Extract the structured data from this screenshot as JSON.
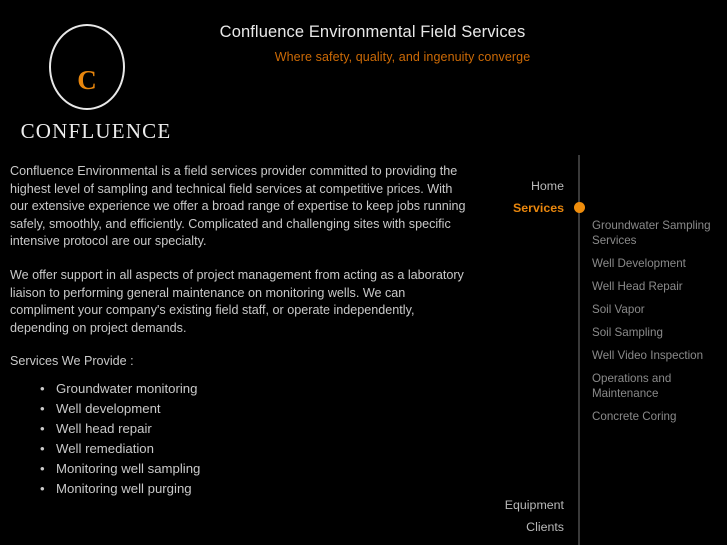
{
  "page": {
    "background_color": "#000000",
    "accent_color": "#e8860d",
    "text_color": "#c9c9c9",
    "muted_text_color": "#8a8a8a",
    "rule_color": "#3a3a3a"
  },
  "header": {
    "logo": {
      "ring_icon": "circle-outline-icon",
      "monogram": "C",
      "wordmark": "CONFLUENCE"
    },
    "title": "Confluence Environmental Field Services",
    "tagline": "Where safety, quality, and ingenuity converge"
  },
  "content": {
    "paragraphs": [
      "Confluence Environmental is a field services provider committed to providing the highest level of sampling and technical field services at competitive prices. With our extensive experience we offer a broad range of expertise to keep jobs running safely, smoothly, and efficiently. Complicated and challenging sites with specific intensive protocol are our specialty.",
      "We offer support in all aspects of project management from acting as a laboratory liaison to performing general maintenance on monitoring wells. We can compliment your company's existing field staff, or operate independently, depending on project demands."
    ],
    "services_heading": "Services We Provide :",
    "services": [
      "Groundwater monitoring",
      "Well development",
      "Well head repair",
      "Well remediation",
      "Monitoring well sampling",
      "Monitoring well purging"
    ]
  },
  "nav": {
    "top_items": [
      {
        "label": "Home",
        "active": false
      },
      {
        "label": "Services",
        "active": true
      },
      {
        "label": "Equipment",
        "active": false
      },
      {
        "label": "Clients",
        "active": false
      }
    ],
    "active_marker_icon": "orange-dot-icon",
    "subitems": [
      "Groundwater Sampling Services",
      "Well Development",
      "Well Head Repair",
      "Soil Vapor",
      "Soil Sampling",
      "Well Video Inspection",
      "Operations and Maintenance",
      "Concrete Coring"
    ]
  }
}
